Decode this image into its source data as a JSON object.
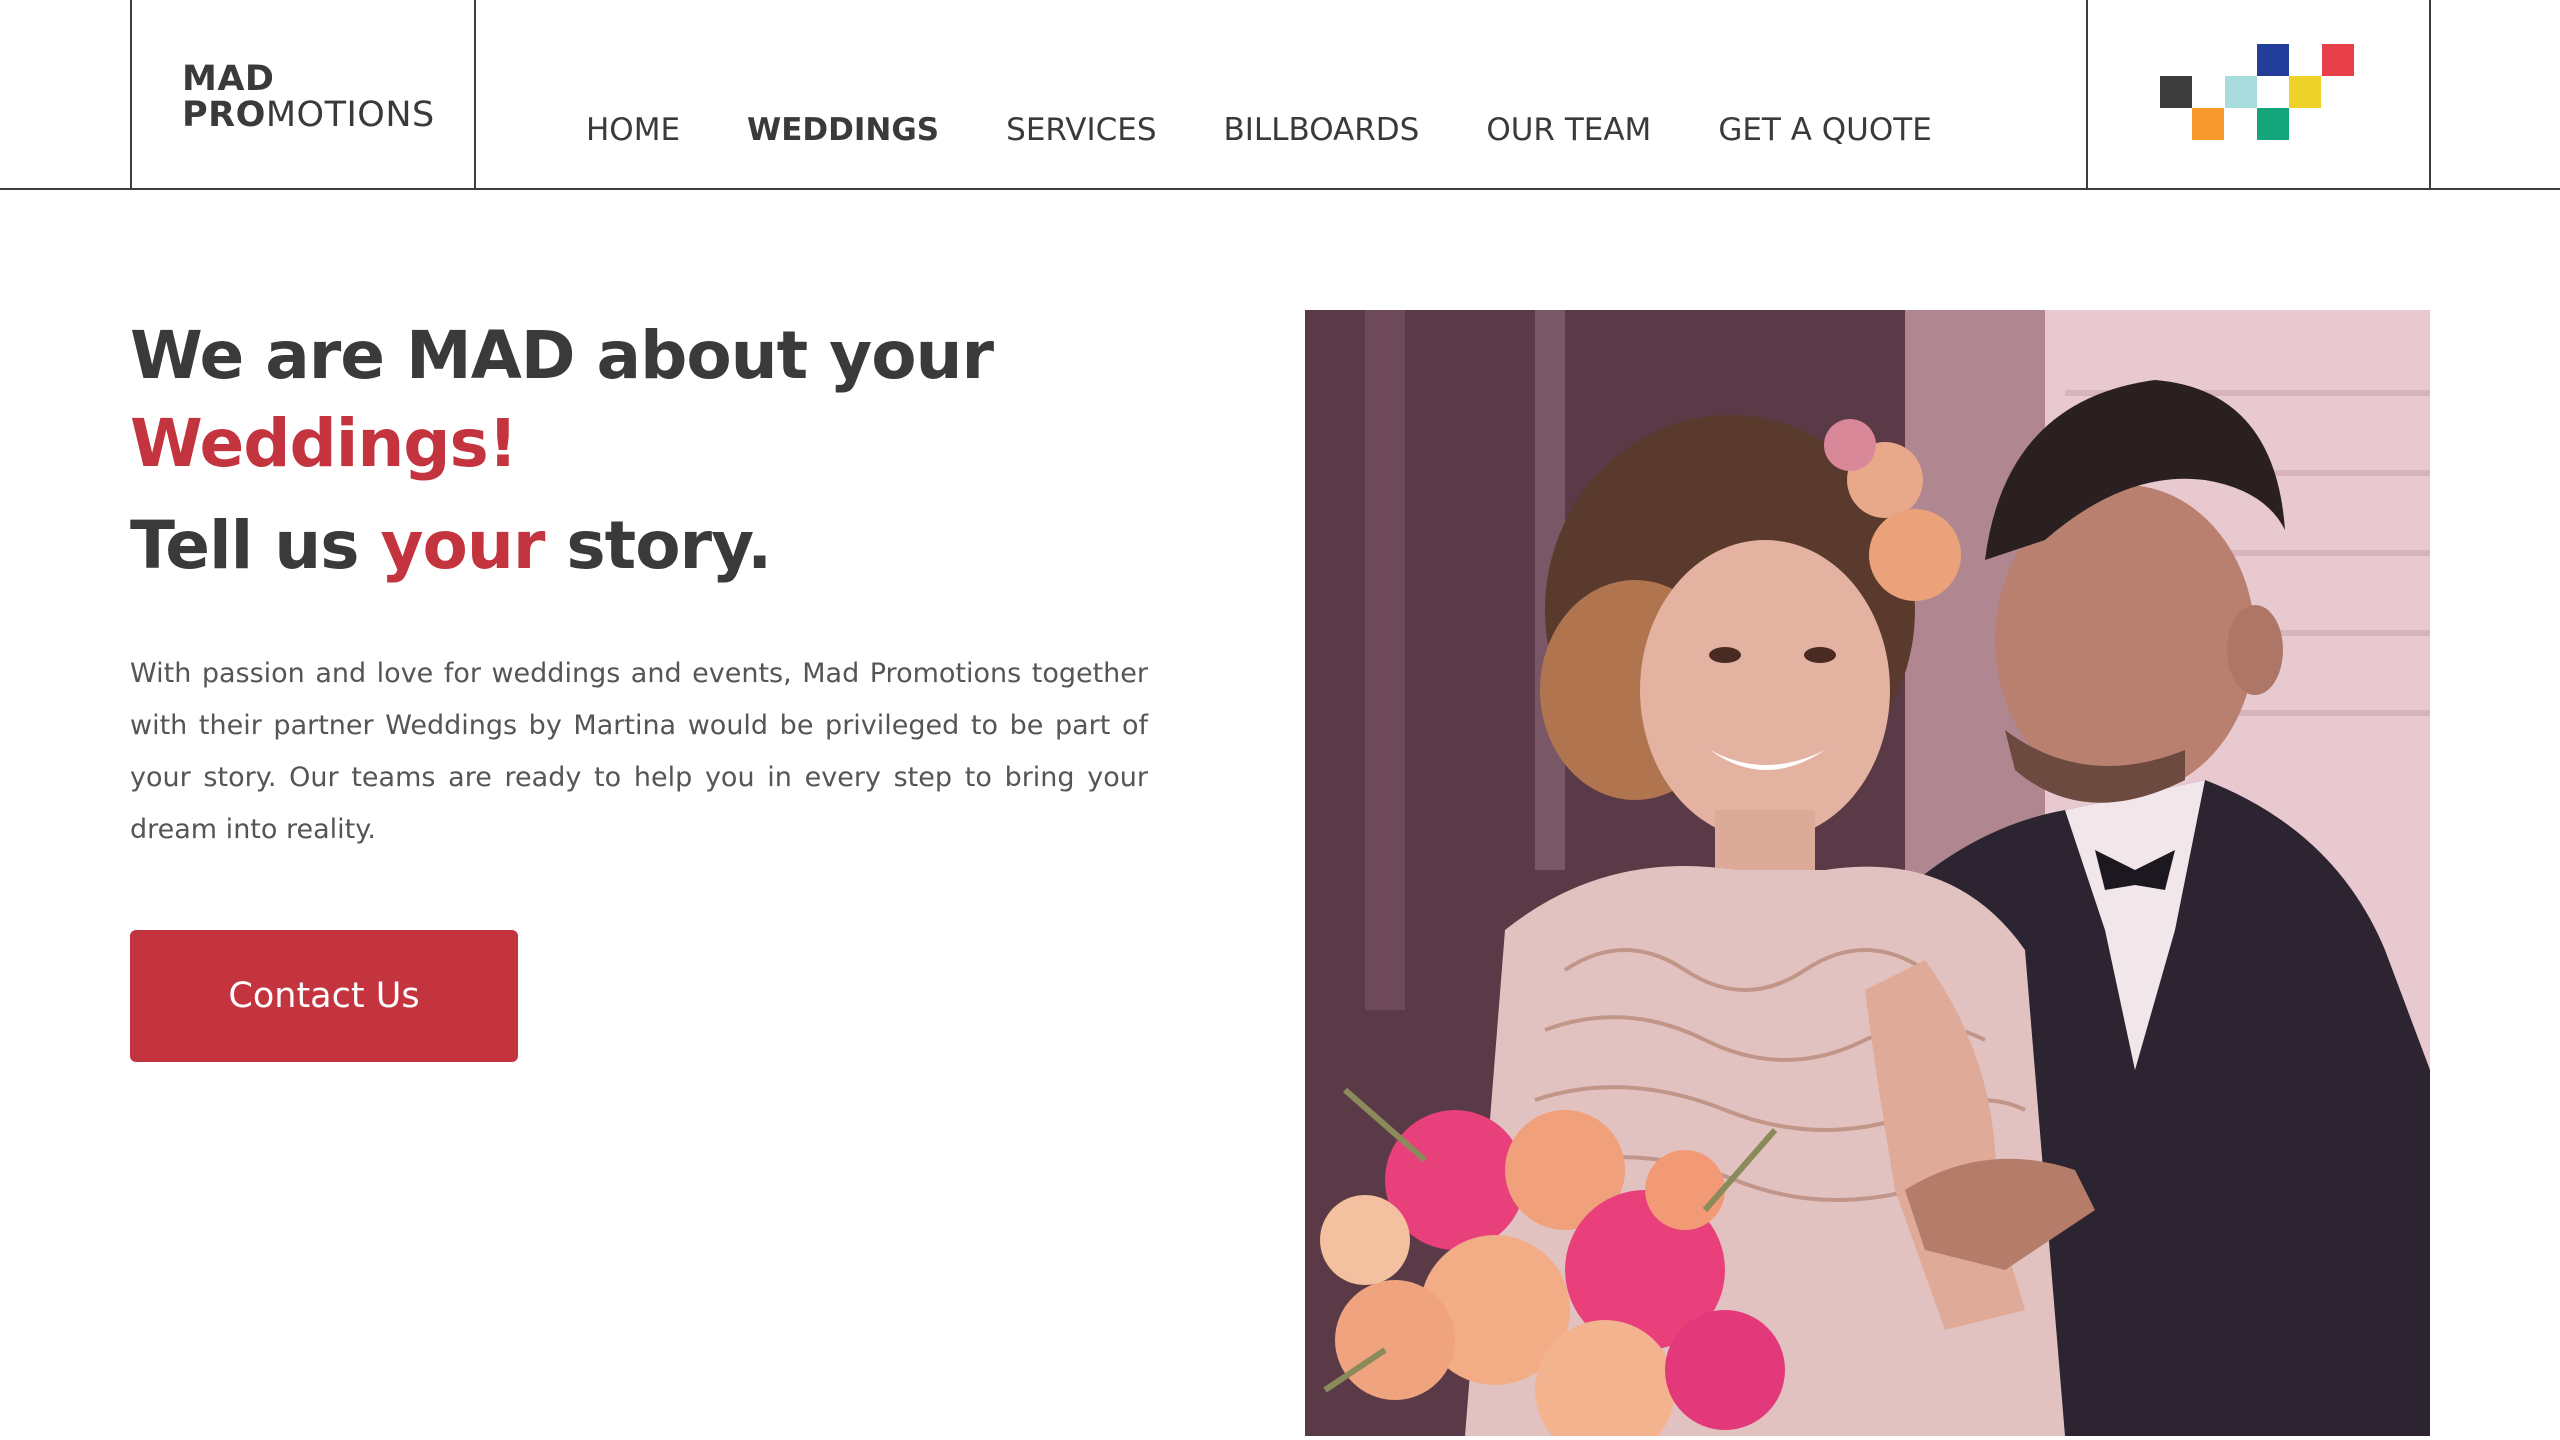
{
  "brand": {
    "line1": "MAD",
    "line2_bold": "PRO",
    "line2_thin": "MOTIONS"
  },
  "nav": {
    "items": [
      {
        "label": "HOME",
        "active": false
      },
      {
        "label": "WEDDINGS",
        "active": true
      },
      {
        "label": "SERVICES",
        "active": false
      },
      {
        "label": "BILLBOARDS",
        "active": false
      },
      {
        "label": "OUR TEAM",
        "active": false
      },
      {
        "label": "GET A QUOTE",
        "active": false
      }
    ]
  },
  "brand_mark": {
    "icon": "pixel-squares-logo",
    "colors": [
      "#3d3d3d",
      "#f79a2e",
      "#a8dcdc",
      "#233e9a",
      "#14a57a",
      "#eed22a",
      "#e8404a"
    ]
  },
  "hero": {
    "title_line1": "We are MAD about your",
    "title_line2": "Weddings!",
    "title_line3_a": "Tell us ",
    "title_line3_b": "your",
    "title_line3_c": " story.",
    "body": "With passion and love for weddings and events, Mad Promotions together with their partner Weddings by Martina would be privileged to be part of your story. Our teams are ready to help you in every step to bring your dream into reality.",
    "cta_label": "Contact Us",
    "image_icon": "wedding-couple-photo"
  },
  "colors": {
    "accent": "#c4343f",
    "text": "#3a3a3a",
    "border": "#3d3d3d"
  }
}
